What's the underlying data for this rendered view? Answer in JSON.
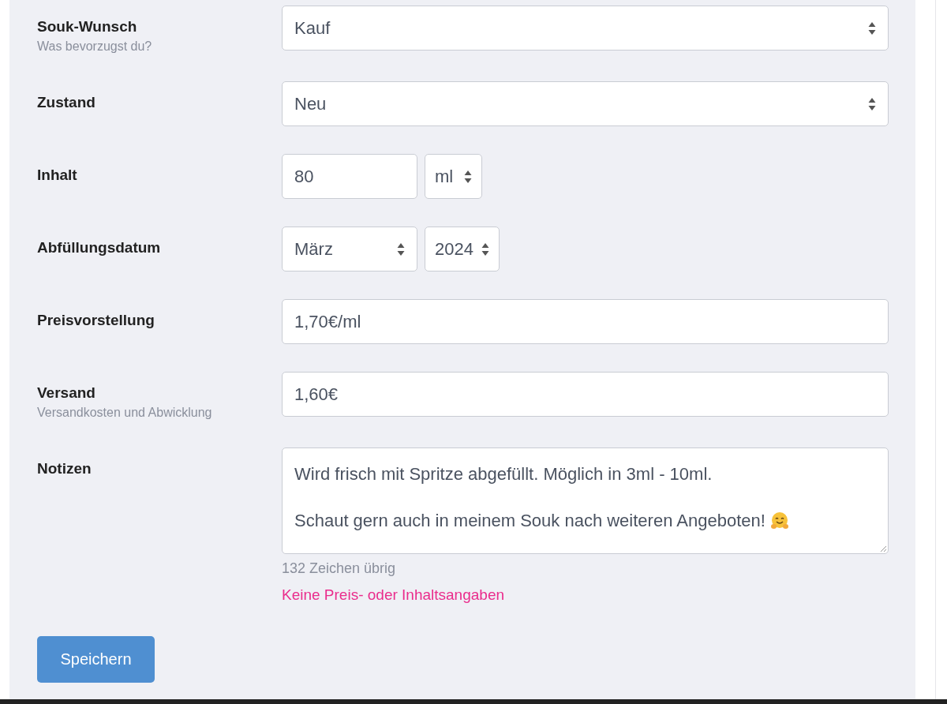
{
  "rows": [
    {
      "label": "Souk-Wunsch",
      "hint": "Was bevorzugst du?",
      "kind": "single",
      "controls": [
        {
          "kind": "select",
          "value": "Kauf"
        }
      ]
    },
    {
      "label": "Zustand",
      "kind": "single",
      "controls": [
        {
          "kind": "select",
          "value": "Neu"
        }
      ]
    },
    {
      "label": "Inhalt",
      "kind": "group",
      "controls": [
        {
          "kind": "input",
          "value": "80"
        },
        {
          "kind": "select",
          "value": "ml"
        }
      ]
    },
    {
      "label": "Abfüllungsdatum",
      "kind": "group",
      "controls": [
        {
          "kind": "select",
          "value": "März"
        },
        {
          "kind": "select",
          "value": "2024"
        }
      ]
    },
    {
      "label": "Preisvorstellung",
      "kind": "single",
      "controls": [
        {
          "kind": "input",
          "value": "1,70€/ml"
        }
      ]
    },
    {
      "label": "Versand",
      "hint": "Versandkosten und Abwicklung",
      "kind": "single",
      "controls": [
        {
          "kind": "input",
          "value": "1,60€"
        }
      ]
    },
    {
      "label": "Notizen",
      "kind": "single",
      "controls": [
        {
          "kind": "textarea",
          "lines": [
            "Wird frisch mit Spritze abgefüllt. Möglich in 3ml - 10ml.",
            "Schaut gern auch in meinem Souk nach weiteren Angeboten!"
          ]
        }
      ],
      "counter": "132 Zeichen übrig",
      "warning": "Keine Preis- oder Inhaltsangaben"
    }
  ],
  "save_button": "Speichern"
}
